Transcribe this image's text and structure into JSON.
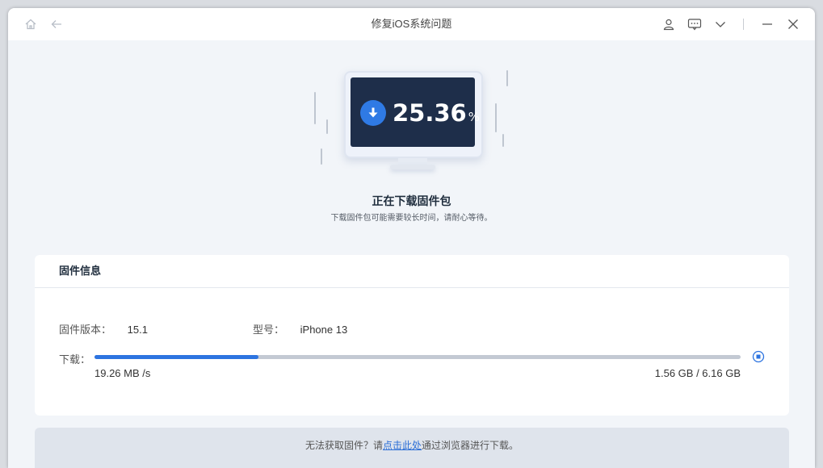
{
  "window": {
    "title": "修复iOS系统问题"
  },
  "status": {
    "percent": "25.36",
    "percent_sign": "%",
    "heading": "正在下载固件包",
    "subheading": "下载固件包可能需要较长时间，请耐心等待。"
  },
  "firmware_info": {
    "title": "固件信息",
    "version_label": "固件版本：",
    "version_value": "15.1",
    "model_label": "型号：",
    "model_value": "iPhone 13",
    "download_label": "下载：",
    "progress_fraction": 0.2536,
    "speed": "19.26 MB /s",
    "size": "1.56 GB / 6.16 GB"
  },
  "footer": {
    "prefix": "无法获取固件？请",
    "link": "点击此处",
    "suffix": "通过浏览器进行下载。"
  },
  "colors": {
    "accent": "#2d74e0",
    "screen": "#1e2e4a"
  },
  "icons": [
    "home-icon",
    "back-arrow-icon",
    "user-icon",
    "feedback-icon",
    "chevron-down-icon",
    "minimize-icon",
    "close-icon",
    "download-arrow-icon",
    "stop-icon"
  ]
}
